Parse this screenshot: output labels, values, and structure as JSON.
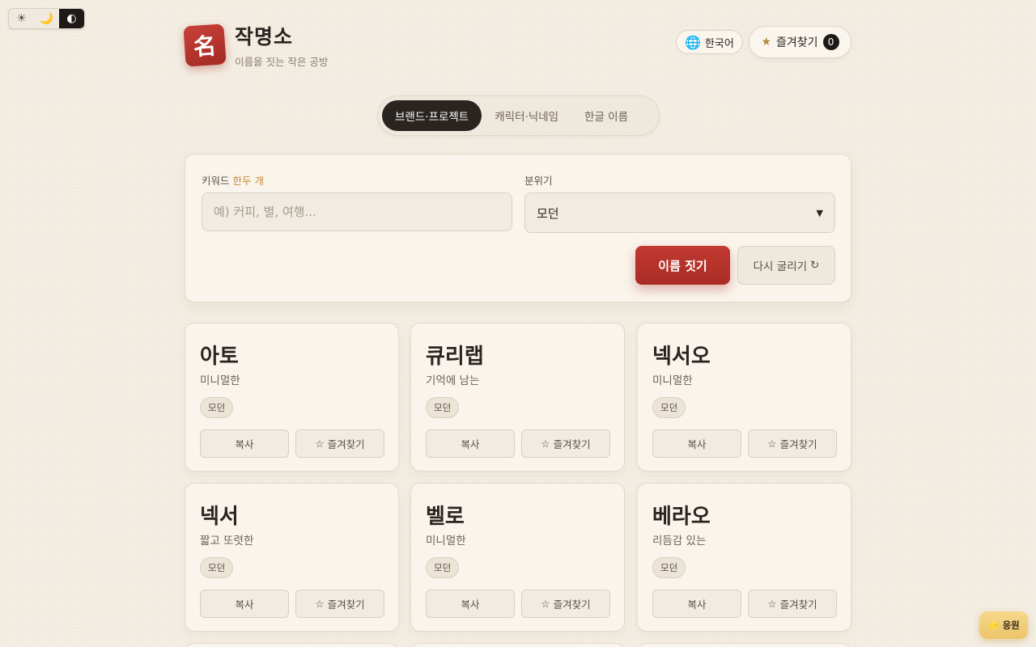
{
  "theme": {
    "options": [
      {
        "icon": "☀",
        "name": "light"
      },
      {
        "icon": "🌙",
        "name": "dark"
      },
      {
        "icon": "◐",
        "name": "auto"
      }
    ],
    "active": "auto"
  },
  "header": {
    "logo_char": "名",
    "title": "작명소",
    "subtitle": "이름을 짓는 작은 공방",
    "language": "한국어",
    "favorites_label": "즐겨찾기",
    "favorites_count": "0"
  },
  "tabs": [
    {
      "label": "브랜드·프로젝트",
      "active": true
    },
    {
      "label": "캐릭터·닉네임",
      "active": false
    },
    {
      "label": "한글 이름",
      "active": false
    }
  ],
  "form": {
    "keyword_label": "키워드",
    "keyword_hint": "한두 개",
    "keyword_placeholder": "예) 커피, 별, 여행...",
    "mood_label": "분위기",
    "mood_value": "모던",
    "generate_label": "이름 짓기",
    "reroll_label": "다시 굴리기"
  },
  "cards": [
    {
      "name": "아토",
      "desc": "미니멀한",
      "tag": "모던"
    },
    {
      "name": "큐리랩",
      "desc": "기억에 남는",
      "tag": "모던"
    },
    {
      "name": "넥서오",
      "desc": "미니멀한",
      "tag": "모던"
    },
    {
      "name": "넥서",
      "desc": "짧고 또렷한",
      "tag": "모던"
    },
    {
      "name": "벨로",
      "desc": "미니멀한",
      "tag": "모던"
    },
    {
      "name": "베라오",
      "desc": "리듬감 있는",
      "tag": "모던"
    }
  ],
  "card_actions": {
    "copy": "복사",
    "favorite": "즐겨찾기"
  },
  "support": {
    "label": "응원"
  },
  "colors": {
    "accent": "#b8322a",
    "background": "#f4eee4",
    "dark": "#1d1a17"
  }
}
